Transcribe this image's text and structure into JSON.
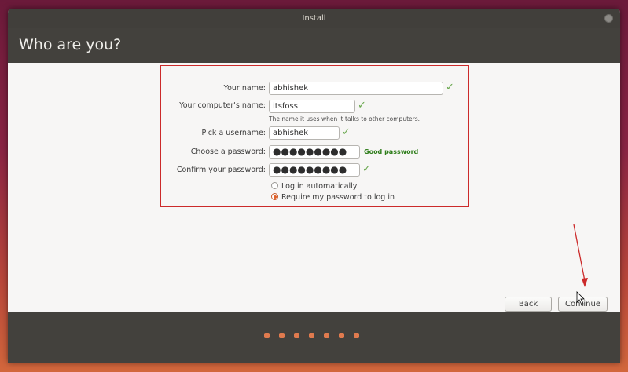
{
  "window": {
    "title": "Install"
  },
  "header": {
    "title": "Who are you?"
  },
  "form": {
    "your_name_label": "Your name:",
    "your_name_value": "abhishek",
    "computer_name_label": "Your computer's name:",
    "computer_name_value": "itsfoss",
    "computer_name_hint": "The name it uses when it talks to other computers.",
    "username_label": "Pick a username:",
    "username_value": "abhishek",
    "password_label": "Choose a password:",
    "password_value": "●●●●●●●●●",
    "password_strength": "Good password",
    "confirm_label": "Confirm your password:",
    "confirm_value": "●●●●●●●●●",
    "login_auto_label": "Log in automatically",
    "login_require_label": "Require my password to log in",
    "selected_login_option": "Require my password to log in"
  },
  "buttons": {
    "back": "Back",
    "continue": "Continue"
  },
  "progress": {
    "total_steps": 7
  },
  "colors": {
    "header_bg": "#43413d",
    "annotation_red": "#cc2a2a",
    "accent_orange": "#e05e26",
    "check_green": "#6aa84f"
  },
  "icons": [
    "close-icon",
    "check-icon",
    "radio-icon",
    "cursor-icon",
    "annotation-arrow-icon"
  ]
}
